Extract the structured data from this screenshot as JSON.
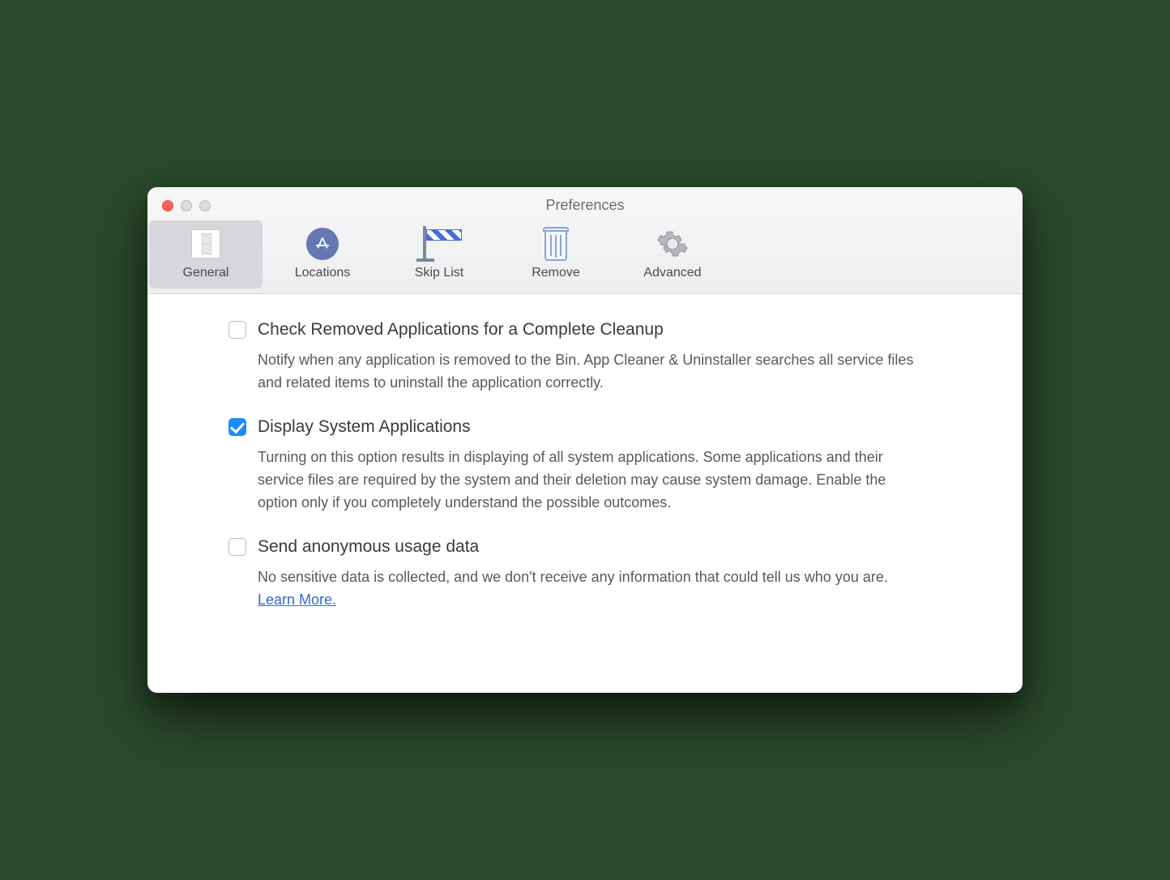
{
  "header": {
    "title": "Preferences"
  },
  "toolbar": {
    "tabs": [
      {
        "label": "General"
      },
      {
        "label": "Locations"
      },
      {
        "label": "Skip List"
      },
      {
        "label": "Remove"
      },
      {
        "label": "Advanced"
      }
    ]
  },
  "options": {
    "cleanup": {
      "title": "Check Removed Applications for a Complete Cleanup",
      "desc": "Notify when any application is removed to the Bin. App Cleaner & Uninstaller searches all service files and related items to uninstall the application correctly."
    },
    "system_apps": {
      "title": "Display System Applications",
      "desc": "Turning on this option results in displaying of all system applications. Some applications and their service files are required by the system and their deletion may cause system damage. Enable the option only if you completely understand the possible outcomes."
    },
    "anon": {
      "title": "Send anonymous usage data",
      "desc_pre": "No sensitive data is collected, and we don't receive any information that could tell us who you are.   ",
      "link": "Learn More."
    }
  }
}
